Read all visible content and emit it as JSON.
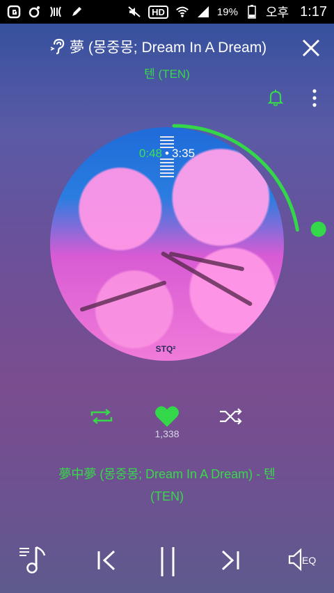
{
  "status_bar": {
    "battery_percent": "19%",
    "ampm": "오후",
    "time": "1:17",
    "hd_label": "HD",
    "icons": [
      "g-icon",
      "circle-icon",
      "pause-x-icon",
      "pen-icon",
      "mute-icon",
      "hd-icon",
      "wifi-icon",
      "signal-icon",
      "battery-icon"
    ]
  },
  "header": {
    "song_title_marquee": "夢 (몽중몽; Dream In A Dream)",
    "artist": "텐 (TEN)"
  },
  "player": {
    "current_time": "0:48",
    "total_time": "3:35",
    "progress": 0.223,
    "album_logo": "STQ²",
    "accent_color": "#34d64a"
  },
  "controls": {
    "likes": "1,338"
  },
  "song": {
    "full_title_line1": "夢中夢 (몽중몽; Dream In A Dream) - 텐",
    "full_title_line2": "(TEN)"
  },
  "bottom": {
    "eq_label": "EQ"
  }
}
